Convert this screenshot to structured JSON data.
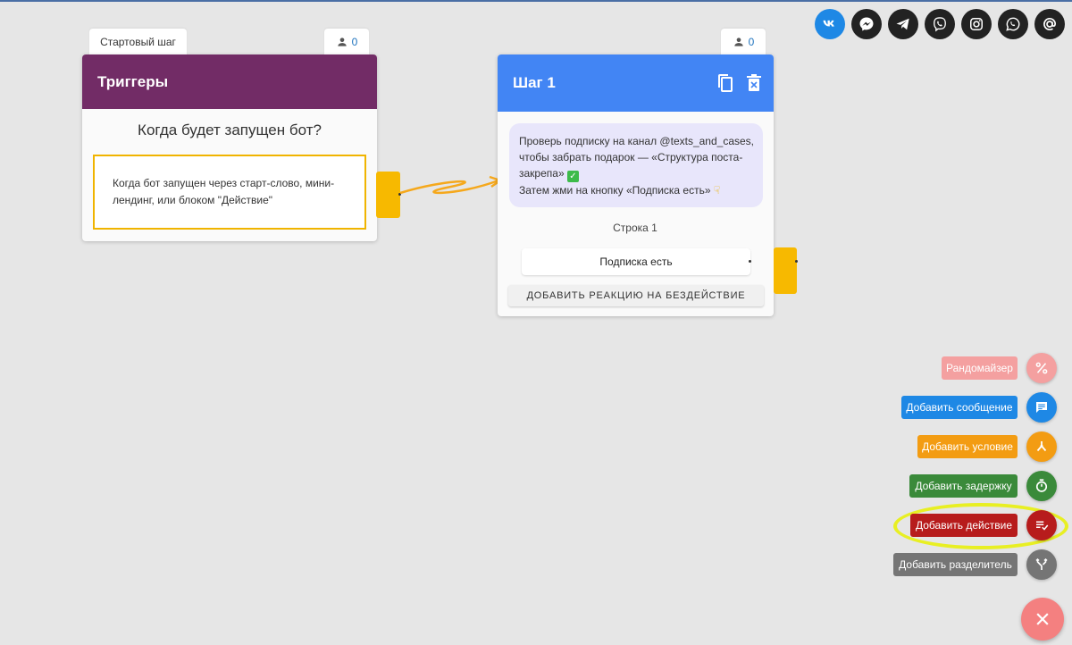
{
  "social": [
    {
      "name": "vk-icon",
      "glyph": "vk"
    },
    {
      "name": "messenger-icon",
      "glyph": "messenger"
    },
    {
      "name": "telegram-icon",
      "glyph": "telegram"
    },
    {
      "name": "viber-icon",
      "glyph": "viber"
    },
    {
      "name": "instagram-icon",
      "glyph": "instagram"
    },
    {
      "name": "whatsapp-icon",
      "glyph": "whatsapp"
    },
    {
      "name": "email-icon",
      "glyph": "@"
    }
  ],
  "start": {
    "tab_label": "Стартовый шаг",
    "subscribers": "0",
    "header": "Триггеры",
    "question": "Когда будет запущен бот?",
    "trigger_text": "Когда бот запущен через старт-слово, мини-лендинг, или блоком \"Действие\"",
    "color": "#722c66"
  },
  "step1": {
    "subscribers": "0",
    "header": "Шаг 1",
    "message_line1": "Проверь подписку на канал @texts_and_cases, чтобы забрать подарок — «Структура поста-закрепа»",
    "message_line2": "Затем жми на кнопку «Подписка есть»",
    "row_label": "Строка 1",
    "button_label": "Подписка есть",
    "idle_button": "ДОБАВИТЬ РЕАКЦИЮ НА БЕЗДЕЙСТВИЕ",
    "color": "#4285f4"
  },
  "actions": [
    {
      "label": "Рандомайзер",
      "icon": "percent-icon",
      "color": "#f4a0a0"
    },
    {
      "label": "Добавить сообщение",
      "icon": "message-icon",
      "color": "#1e88e5"
    },
    {
      "label": "Добавить условие",
      "icon": "condition-icon",
      "color": "#f39c12"
    },
    {
      "label": "Добавить задержку",
      "icon": "timer-icon",
      "color": "#3a8a3a"
    },
    {
      "label": "Добавить действие",
      "icon": "action-icon",
      "color": "#b71c1c"
    },
    {
      "label": "Добавить разделитель",
      "icon": "split-icon",
      "color": "#757575"
    }
  ],
  "close_icon": "close-icon"
}
